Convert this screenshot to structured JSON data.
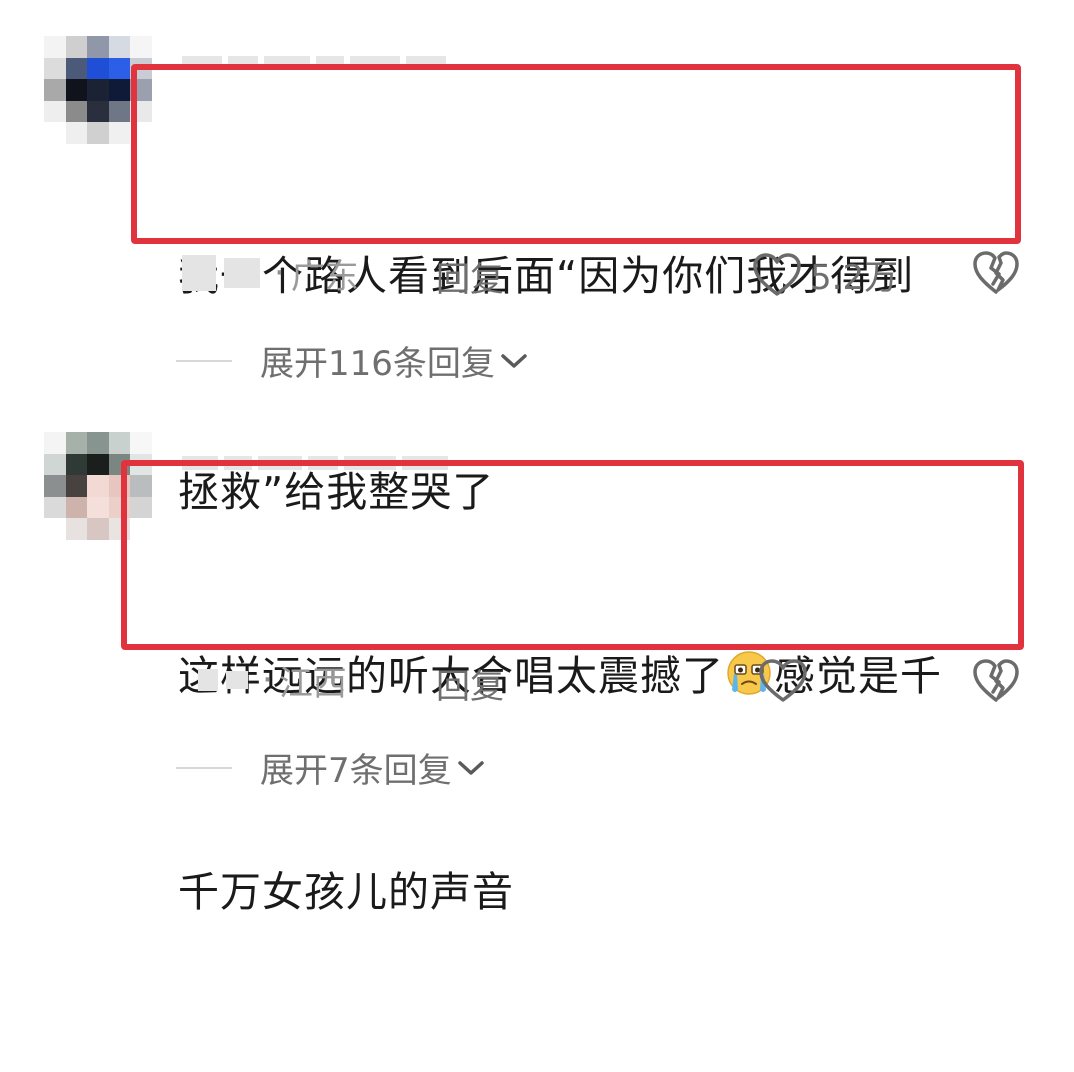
{
  "comments": [
    {
      "text_line1": "我一个路人看到后面“因为你们我才得到",
      "text_line2": "拯救”给我整哭了",
      "location": "广东",
      "reply_label": "回复",
      "likes": "5.2万",
      "expand_label": "展开116条回复"
    },
    {
      "text_line1_part1": "这样远远的听大合唱太震撼了",
      "text_line1_part2": "感觉是千",
      "text_line2": "千万女孩儿的声音",
      "location": "江西",
      "reply_label": "回复",
      "likes": "",
      "expand_label": "展开7条回复"
    }
  ],
  "icons": {
    "like": "heart-outline-icon",
    "dislike": "broken-heart-icon",
    "expand": "chevron-down-icon",
    "emoji": "crying-face-emoji"
  },
  "colors": {
    "highlight_border": "#e0333d",
    "text": "#1a1a1a",
    "meta": "#8e8e8e"
  },
  "meta_separator": "·"
}
